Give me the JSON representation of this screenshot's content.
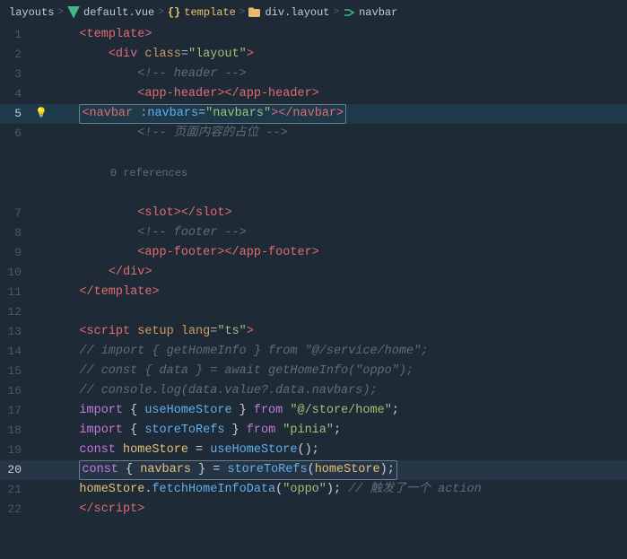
{
  "breadcrumb": {
    "items": [
      {
        "label": "layouts",
        "type": "text"
      },
      {
        "label": ">",
        "type": "sep"
      },
      {
        "label": "V",
        "type": "v-icon"
      },
      {
        "label": "default.vue",
        "type": "text"
      },
      {
        "label": ">",
        "type": "sep"
      },
      {
        "label": "{}",
        "type": "curly"
      },
      {
        "label": "template",
        "type": "highlight"
      },
      {
        "label": ">",
        "type": "sep"
      },
      {
        "label": "folder",
        "type": "folder-icon"
      },
      {
        "label": "div.layout",
        "type": "text"
      },
      {
        "label": ">",
        "type": "sep"
      },
      {
        "label": "tag",
        "type": "tag-icon"
      },
      {
        "label": "navbar",
        "type": "text"
      }
    ]
  },
  "lines": [
    {
      "num": 1,
      "tokens": [
        {
          "text": "    ",
          "class": ""
        },
        {
          "text": "<",
          "class": "c-tag"
        },
        {
          "text": "template",
          "class": "c-tag"
        },
        {
          "text": ">",
          "class": "c-tag"
        }
      ]
    },
    {
      "num": 2,
      "tokens": [
        {
          "text": "        ",
          "class": ""
        },
        {
          "text": "<",
          "class": "c-tag"
        },
        {
          "text": "div",
          "class": "c-tag"
        },
        {
          "text": " ",
          "class": ""
        },
        {
          "text": "class",
          "class": "c-attr"
        },
        {
          "text": "=",
          "class": "c-punct"
        },
        {
          "text": "\"layout\"",
          "class": "c-string"
        },
        {
          "text": ">",
          "class": "c-tag"
        }
      ]
    },
    {
      "num": 3,
      "tokens": [
        {
          "text": "            ",
          "class": ""
        },
        {
          "text": "<!-- header -->",
          "class": "c-comment"
        }
      ]
    },
    {
      "num": 4,
      "tokens": [
        {
          "text": "            ",
          "class": ""
        },
        {
          "text": "<",
          "class": "c-tag"
        },
        {
          "text": "app-header",
          "class": "c-tag"
        },
        {
          "text": "></",
          "class": "c-tag"
        },
        {
          "text": "app-header",
          "class": "c-tag"
        },
        {
          "text": ">",
          "class": "c-tag"
        }
      ]
    },
    {
      "num": 5,
      "hasBulb": true,
      "hasBox": true,
      "tokens": [
        {
          "text": "            ",
          "class": ""
        },
        {
          "text": "<",
          "class": "c-tag"
        },
        {
          "text": "navbar",
          "class": "c-tag"
        },
        {
          "text": " ",
          "class": ""
        },
        {
          "text": ":",
          "class": "c-attr"
        },
        {
          "text": "navbars",
          "class": "c-attr-bind"
        },
        {
          "text": "=",
          "class": "c-punct"
        },
        {
          "text": "\"navbars\"",
          "class": "c-string"
        },
        {
          "text": "></",
          "class": "c-tag"
        },
        {
          "text": "navbar",
          "class": "c-tag"
        },
        {
          "text": ">",
          "class": "c-tag"
        }
      ]
    },
    {
      "num": 6,
      "tokens": [
        {
          "text": "            ",
          "class": ""
        },
        {
          "text": "<!-- 页面内容的占位 -->",
          "class": "c-comment-zh"
        }
      ]
    },
    {
      "num": 6.5,
      "isHint": true,
      "tokens": [
        {
          "text": "            0 references",
          "class": "ref-hint"
        }
      ]
    },
    {
      "num": 7,
      "tokens": [
        {
          "text": "            ",
          "class": ""
        },
        {
          "text": "<",
          "class": "c-tag"
        },
        {
          "text": "slot",
          "class": "c-tag"
        },
        {
          "text": "></",
          "class": "c-tag"
        },
        {
          "text": "slot",
          "class": "c-tag"
        },
        {
          "text": ">",
          "class": "c-tag"
        }
      ]
    },
    {
      "num": 8,
      "tokens": [
        {
          "text": "            ",
          "class": ""
        },
        {
          "text": "<!-- footer -->",
          "class": "c-comment"
        }
      ]
    },
    {
      "num": 9,
      "tokens": [
        {
          "text": "            ",
          "class": ""
        },
        {
          "text": "<",
          "class": "c-tag"
        },
        {
          "text": "app-footer",
          "class": "c-tag"
        },
        {
          "text": "></",
          "class": "c-tag"
        },
        {
          "text": "app-footer",
          "class": "c-tag"
        },
        {
          "text": ">",
          "class": "c-tag"
        }
      ]
    },
    {
      "num": 10,
      "tokens": [
        {
          "text": "        ",
          "class": ""
        },
        {
          "text": "</",
          "class": "c-tag"
        },
        {
          "text": "div",
          "class": "c-tag"
        },
        {
          "text": ">",
          "class": "c-tag"
        }
      ]
    },
    {
      "num": 11,
      "tokens": [
        {
          "text": "    ",
          "class": ""
        },
        {
          "text": "</",
          "class": "c-tag"
        },
        {
          "text": "template",
          "class": "c-tag"
        },
        {
          "text": ">",
          "class": "c-tag"
        }
      ]
    },
    {
      "num": 12,
      "tokens": []
    },
    {
      "num": 13,
      "tokens": [
        {
          "text": "    ",
          "class": ""
        },
        {
          "text": "<",
          "class": "c-tag"
        },
        {
          "text": "script",
          "class": "c-tag"
        },
        {
          "text": " ",
          "class": ""
        },
        {
          "text": "setup",
          "class": "c-attr"
        },
        {
          "text": " ",
          "class": ""
        },
        {
          "text": "lang",
          "class": "c-attr"
        },
        {
          "text": "=",
          "class": "c-punct"
        },
        {
          "text": "\"ts\"",
          "class": "c-string"
        },
        {
          "text": ">",
          "class": "c-tag"
        }
      ]
    },
    {
      "num": 14,
      "tokens": [
        {
          "text": "    // import { getHomeInfo } from \"@/service/home\";",
          "class": "c-js-comment"
        }
      ]
    },
    {
      "num": 15,
      "tokens": [
        {
          "text": "    // const { data } = await getHomeInfo(\"oppo\");",
          "class": "c-js-comment"
        }
      ]
    },
    {
      "num": 16,
      "tokens": [
        {
          "text": "    // console.log(data.value?.data.navbars);",
          "class": "c-js-comment"
        }
      ]
    },
    {
      "num": 17,
      "tokens": [
        {
          "text": "    ",
          "class": ""
        },
        {
          "text": "import",
          "class": "c-keyword"
        },
        {
          "text": " { ",
          "class": "c-white"
        },
        {
          "text": "useHomeStore",
          "class": "c-func"
        },
        {
          "text": " } ",
          "class": "c-white"
        },
        {
          "text": "from",
          "class": "c-keyword"
        },
        {
          "text": " ",
          "class": ""
        },
        {
          "text": "\"@/store/home\"",
          "class": "c-import-path"
        },
        {
          "text": ";",
          "class": "c-white"
        }
      ]
    },
    {
      "num": 18,
      "tokens": [
        {
          "text": "    ",
          "class": ""
        },
        {
          "text": "import",
          "class": "c-keyword"
        },
        {
          "text": " { ",
          "class": "c-white"
        },
        {
          "text": "storeToRefs",
          "class": "c-func"
        },
        {
          "text": " } ",
          "class": "c-white"
        },
        {
          "text": "from",
          "class": "c-keyword"
        },
        {
          "text": " ",
          "class": ""
        },
        {
          "text": "\"pinia\"",
          "class": "c-import-path"
        },
        {
          "text": ";",
          "class": "c-white"
        }
      ]
    },
    {
      "num": 19,
      "tokens": [
        {
          "text": "    ",
          "class": ""
        },
        {
          "text": "const",
          "class": "c-keyword"
        },
        {
          "text": " ",
          "class": ""
        },
        {
          "text": "homeStore",
          "class": "c-var"
        },
        {
          "text": " = ",
          "class": "c-white"
        },
        {
          "text": "useHomeStore",
          "class": "c-func"
        },
        {
          "text": "();",
          "class": "c-white"
        }
      ]
    },
    {
      "num": 20,
      "hasConstBox": true,
      "tokens": [
        {
          "text": "    ",
          "class": ""
        },
        {
          "text": "const",
          "class": "c-keyword"
        },
        {
          "text": " { ",
          "class": "c-white"
        },
        {
          "text": "navbars",
          "class": "c-var"
        },
        {
          "text": " } = ",
          "class": "c-white"
        },
        {
          "text": "storeToRefs",
          "class": "c-func"
        },
        {
          "text": "(",
          "class": "c-white"
        },
        {
          "text": "homeStore",
          "class": "c-var"
        },
        {
          "text": ");",
          "class": "c-white"
        }
      ]
    },
    {
      "num": 21,
      "tokens": [
        {
          "text": "    ",
          "class": ""
        },
        {
          "text": "homeStore",
          "class": "c-var"
        },
        {
          "text": ".",
          "class": "c-white"
        },
        {
          "text": "fetchHomeInfoData",
          "class": "c-func"
        },
        {
          "text": "(",
          "class": "c-white"
        },
        {
          "text": "\"oppo\"",
          "class": "c-string2"
        },
        {
          "text": "); ",
          "class": "c-white"
        },
        {
          "text": "// 触发了一个 action",
          "class": "c-js-comment"
        }
      ]
    },
    {
      "num": 22,
      "tokens": [
        {
          "text": "    ",
          "class": ""
        },
        {
          "text": "</",
          "class": "c-tag"
        },
        {
          "text": "script",
          "class": "c-tag"
        },
        {
          "text": ">",
          "class": "c-tag"
        }
      ]
    }
  ]
}
